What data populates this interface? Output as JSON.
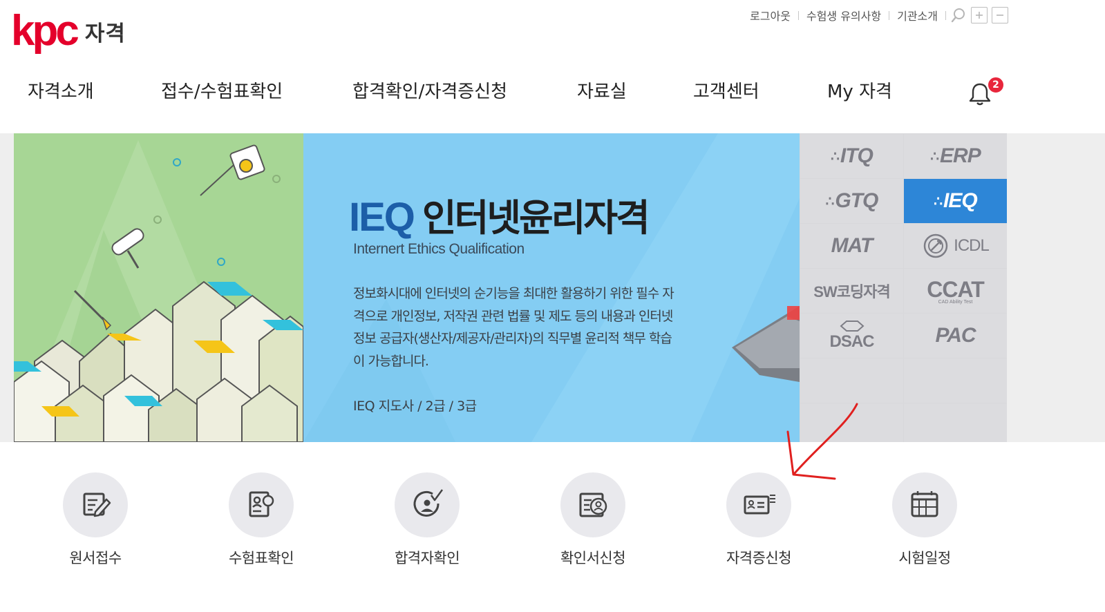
{
  "logo": {
    "brand": "kpc",
    "sub": "자격"
  },
  "util": {
    "links": [
      "로그아웃",
      "수험생 유의사항",
      "기관소개"
    ],
    "icons": [
      "search-icon",
      "zoom-in-icon",
      "zoom-out-icon"
    ]
  },
  "nav": {
    "items": [
      "자격소개",
      "접수/수험표확인",
      "합격확인/자격증신청",
      "자료실",
      "고객센터",
      "My 자격"
    ],
    "notification_count": "2"
  },
  "banner": {
    "code": "IEQ",
    "title": "인터넷윤리자격",
    "subtitle": "Internert Ethics Qualification",
    "description": "정보화시대에 인터넷의 순기능을 최대한 활용하기 위한 필수 자격으로 개인정보, 저작권 관련 법률 및 제도 등의 내용과 인터넷 정보 공급자(생산자/제공자/관리자)의 직무별 윤리적 책무 학습이 가능합니다.",
    "grades": "IEQ 지도사 / 2급 / 3급",
    "colors": {
      "left": "#a7d695",
      "main": "#84cdf3",
      "code": "#1c5ea8",
      "active_tab": "#2d86d7"
    }
  },
  "certs": {
    "items": [
      "ITQ",
      "ERP",
      "GTQ",
      "IEQ",
      "MAT",
      "ICDL",
      "SW코딩자격",
      "CCAT",
      "DSAC",
      "PAC"
    ],
    "active": "IEQ",
    "ccat_tagline": "CAD Ability Test"
  },
  "quick_menu": {
    "items": [
      "원서접수",
      "수험표확인",
      "합격자확인",
      "확인서신청",
      "자격증신청",
      "시험일정"
    ]
  },
  "annotation": {
    "arrow_color": "#e0201f"
  }
}
